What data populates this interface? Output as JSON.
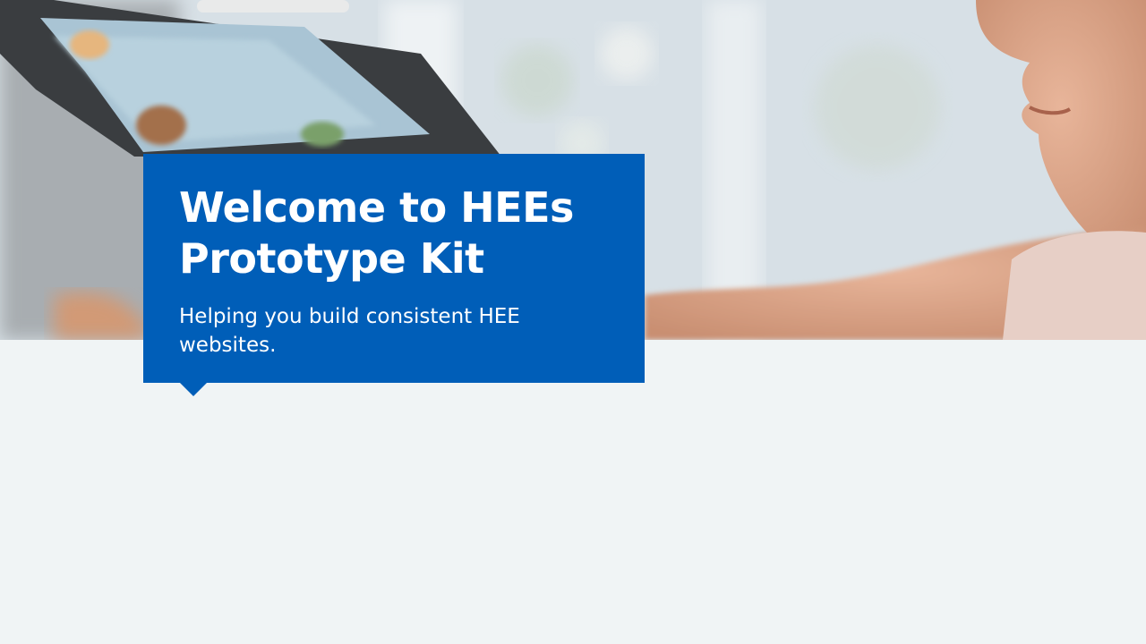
{
  "hero": {
    "image": "child-using-tablet-photo",
    "title": "Welcome to HEEs Prototype Kit",
    "subtitle": "Helping you build consistent HEE websites."
  },
  "colors": {
    "brand_blue": "#005eb8",
    "page_background": "#f0f4f5",
    "text_on_blue": "#ffffff"
  }
}
